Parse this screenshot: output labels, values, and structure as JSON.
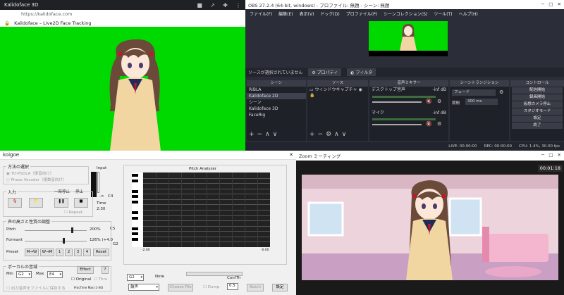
{
  "kalidoface": {
    "window_title": "Kalidoface 3D",
    "url": "https://kalidoface.com",
    "page_title": "Kalidoface – Live2D Face Tracking",
    "bg_color": "#00d900"
  },
  "obs": {
    "window_title": "OBS 27.2.4 (64-bit, windows) - プロファイル: 無題 - シーン: 無題",
    "menu": [
      "ファイル(F)",
      "編集(E)",
      "表示(V)",
      "ドック(D)",
      "プロファイル(P)",
      "シーンコレクション(S)",
      "ツール(T)",
      "ヘルプ(H)"
    ],
    "no_source_text": "ソースが選択されていません",
    "properties_label": "プロパティ",
    "filters_label": "フィルタ",
    "docks": {
      "scenes_title": "シーン",
      "scenes": [
        "RiBLA",
        "Kalidoface 2D",
        "シーン",
        "Kalidoface 3D",
        "FaceRig"
      ],
      "sources_title": "ソース",
      "source_item": "ウィンドウキャプチャ",
      "mixer_title": "音声ミキサー",
      "mixer_desktop": "デスクトップ音声",
      "mixer_mic": "マイク",
      "mixer_db1": "-inf dB",
      "mixer_db2": "-inf dB",
      "transition_title": "シーントランジション",
      "transition_value": "フェード",
      "duration_label": "期間",
      "duration_value": "300 ms",
      "controls_title": "コントロール",
      "controls": [
        "配信開始",
        "録画開始",
        "仮想カメラ停止",
        "スタジオモード",
        "設定",
        "終了"
      ]
    },
    "status": {
      "live": "LIVE: 00:00:00",
      "rec": "REC: 00:00:00",
      "cpu": "CPU: 1.4%, 30.00 fps"
    }
  },
  "koigoe": {
    "window_title": "koigoe",
    "method_group": "方法の選択",
    "method_options": [
      "TD-PSOLA（単音向け）",
      "Phase Vocoder（複数音向け）"
    ],
    "input_label": "Input",
    "input_group": "入力",
    "pause_label": "一時停止",
    "stop_label": "停止",
    "repeat_label": "Repeat",
    "time_label": "Time",
    "time_value": "2:30",
    "minus_inf": "-∞",
    "c4_label": "C4",
    "voice_group": "声の高さと性質の調整",
    "pitch_label": "Pitch",
    "pitch_value": "200%",
    "c5_label": "C5",
    "formant_label": "Formant",
    "formant_value": "126% (+4.0",
    "g2_label": "G2",
    "preset_label": "Preset",
    "presets": [
      "M→W",
      "W→M",
      "1",
      "2",
      "3",
      "4",
      "Reset"
    ],
    "vocal_group": "ボーカルの音域",
    "min_label": "Min",
    "min_value": "G2",
    "max_label": "Max",
    "max_value": "E4",
    "effect_label": "Effect",
    "original_label": "Original",
    "thru_label": "Thru",
    "save_label": "出力音声をファイルに保存する",
    "proctime": "ProcTime  Max  (1-40)",
    "pitch_analyzer": "Pitch Analyzer",
    "x_tick_left": "-2.00",
    "x_tick_right": "-0.00",
    "note_label": "Note",
    "note_value": "G2",
    "conf_label": "ConfTh",
    "conf_value": "0.5",
    "voice_combo": "鼓声",
    "choose_file": "Choose File",
    "dump_label": "Dump",
    "batch_label": "Batch",
    "settings_label": "設定"
  },
  "zoom": {
    "window_title": "Zoom ミーティング",
    "timer": "00:01:18"
  }
}
